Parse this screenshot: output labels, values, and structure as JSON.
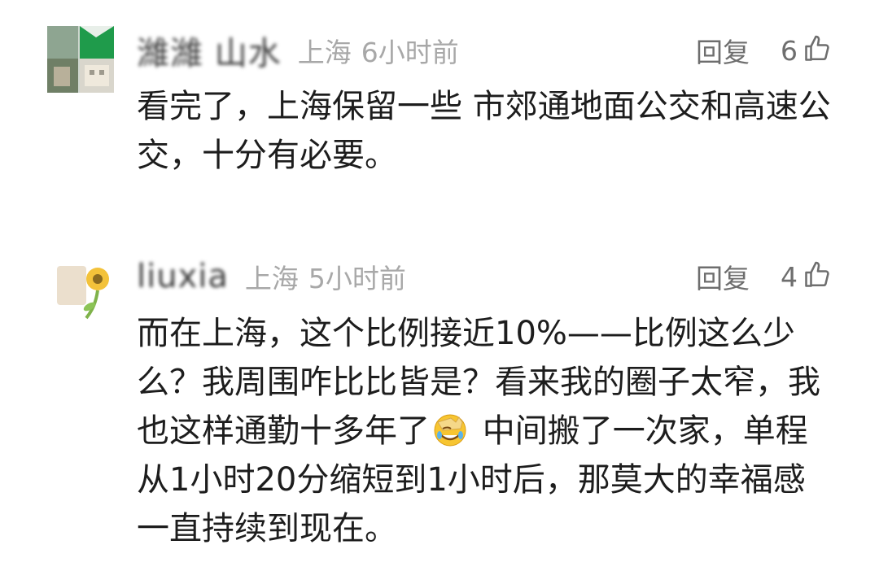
{
  "comments": [
    {
      "username": "濰濰 山水",
      "location": "上海",
      "time": "6小时前",
      "reply_label": "回复",
      "like_count": "6",
      "text": "看完了，上海保留一些 市郊通地面公交和高速公交，十分有必要。"
    },
    {
      "username": "liuxia",
      "location": "上海",
      "time": "5小时前",
      "reply_label": "回复",
      "like_count": "4",
      "text_before_emoji": "而在上海，这个比例接近10%——比例这么少么？我周围咋比比皆是？看来我的圈子太窄，我也这样通勤十多年了",
      "emoji": "face-palm-emoji",
      "text_after_emoji": " 中间搬了一次家，单程从1小时20分缩短到1小时后，那莫大的幸福感一直持续到现在。"
    }
  ],
  "icons": {
    "like": "thumbs-up-icon"
  },
  "colors": {
    "meta_text": "#a8a8a8",
    "action_text": "#6e6e6e",
    "body_text": "#1d1d1d"
  }
}
